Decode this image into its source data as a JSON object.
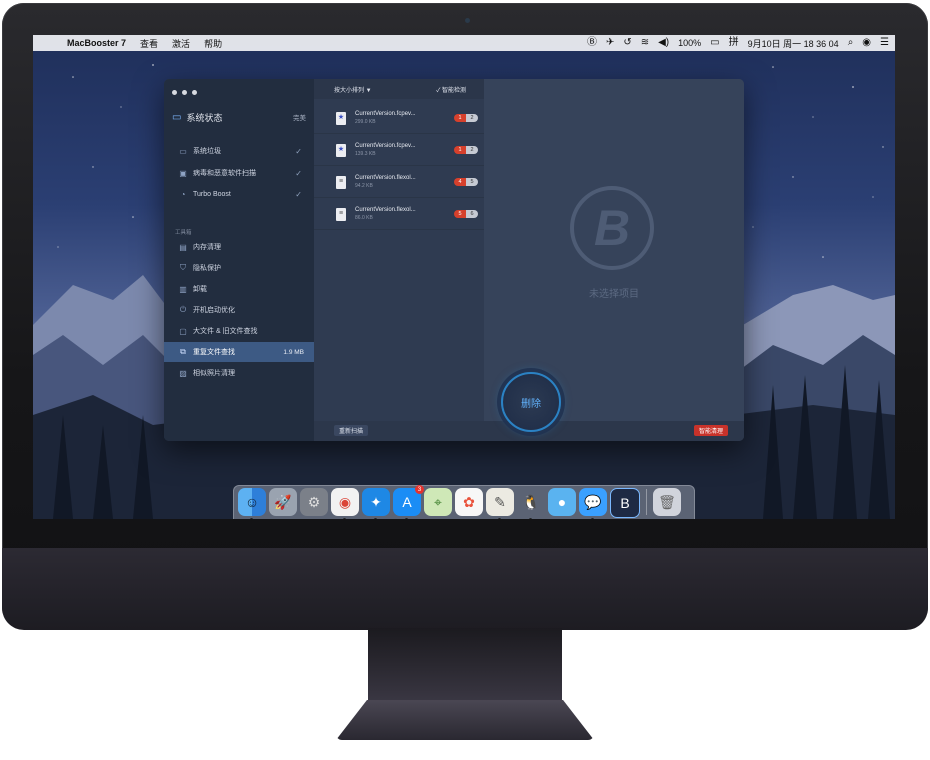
{
  "menubar": {
    "app_name": "MacBooster 7",
    "menus": [
      "查看",
      "激活",
      "帮助"
    ],
    "battery_percent": "100%",
    "datetime": "9月10日 周一 18 36 04"
  },
  "sidebar": {
    "header": "系统状态",
    "header_status": "完美",
    "status_items": [
      {
        "label": "系统垃圾",
        "icon": "monitor-icon",
        "done": "✓"
      },
      {
        "label": "病毒和恶意软件扫描",
        "icon": "shield-scan-icon",
        "done": "✓"
      },
      {
        "label": "Turbo Boost",
        "icon": "rocket-icon",
        "done": "✓"
      }
    ],
    "toolbox_title": "工具箱",
    "tools": [
      {
        "label": "内存清理",
        "icon": "memory-icon"
      },
      {
        "label": "隐私保护",
        "icon": "privacy-shield-icon"
      },
      {
        "label": "卸载",
        "icon": "trash-icon"
      },
      {
        "label": "开机启动优化",
        "icon": "power-icon"
      },
      {
        "label": "大文件 & 旧文件查找",
        "icon": "box-icon"
      },
      {
        "label": "重复文件查找",
        "icon": "duplicate-icon",
        "size": "1.9 MB",
        "active": true
      },
      {
        "label": "相似照片清理",
        "icon": "photo-icon"
      }
    ]
  },
  "list": {
    "sort_label": "按大小排列 ▼",
    "smart_detect": "✓ 智能检测",
    "files": [
      {
        "name": "CurrentVersion.fcpev...",
        "size": "299.0 KB",
        "badge_red": "1",
        "badge_gray": "2",
        "glyph": "★"
      },
      {
        "name": "CurrentVersion.fcpev...",
        "size": "139.3 KB",
        "badge_red": "1",
        "badge_gray": "2",
        "glyph": "★"
      },
      {
        "name": "CurrentVersion.flexol...",
        "size": "94.2 KB",
        "badge_red": "4",
        "badge_gray": "5",
        "glyph": "≡"
      },
      {
        "name": "CurrentVersion.flexol...",
        "size": "86.0 KB",
        "badge_red": "5",
        "badge_gray": "6",
        "glyph": "≡"
      }
    ]
  },
  "detail": {
    "logo_letter": "B",
    "empty_text": "未选择项目"
  },
  "actions": {
    "rescan": "重新扫描",
    "delete": "删除",
    "smart_clean": "智能清理"
  },
  "dock": {
    "appstore_badge": "3"
  }
}
